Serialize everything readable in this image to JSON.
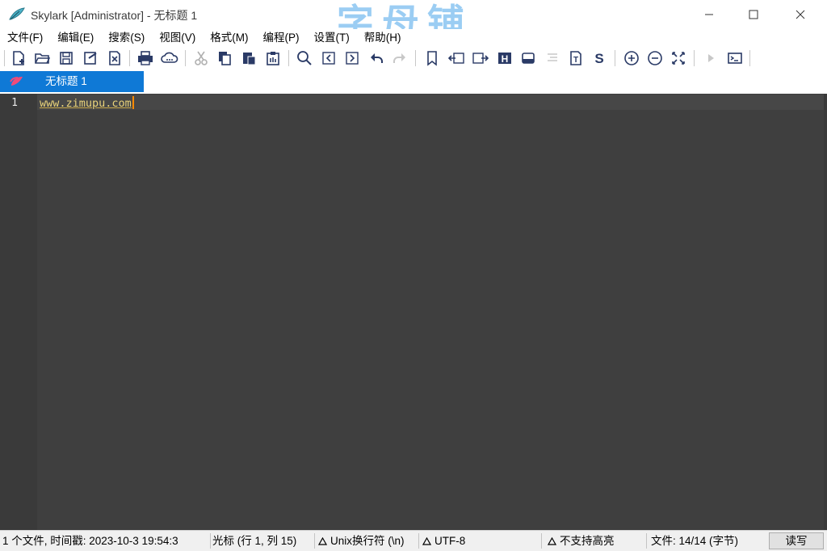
{
  "window": {
    "title": "Skylark [Administrator] - 无标题 1",
    "app_icon": "skylark-feather-icon",
    "controls": [
      "minimize-icon",
      "maximize-icon",
      "close-icon"
    ]
  },
  "watermark": {
    "cn": "字母铺",
    "en": "zimupu.com"
  },
  "menu": [
    {
      "label": "文件(F)"
    },
    {
      "label": "编辑(E)"
    },
    {
      "label": "搜索(S)"
    },
    {
      "label": "视图(V)"
    },
    {
      "label": "格式(M)"
    },
    {
      "label": "编程(P)"
    },
    {
      "label": "设置(T)"
    },
    {
      "label": "帮助(H)"
    }
  ],
  "toolbar": {
    "icons": [
      "new-file-icon",
      "open-folder-icon",
      "save-icon",
      "save-as-icon",
      "close-file-icon",
      "print-icon",
      "cloud-icon",
      "cut-icon",
      "copy-icon",
      "paste-icon",
      "clipboard-icon",
      "search-icon",
      "prev-match-icon",
      "next-match-icon",
      "undo-icon",
      "redo-icon",
      "bookmark-icon",
      "indent-left-icon",
      "indent-right-icon",
      "heading-icon",
      "drive-icon",
      "list-icon",
      "text-icon",
      "s-icon",
      "zoom-in-icon",
      "zoom-out-icon",
      "fullscreen-icon",
      "play-icon",
      "terminal-icon"
    ],
    "h_label": "H",
    "t_label": "T",
    "s_label": "S"
  },
  "tabs": [
    {
      "label": "无标题 1",
      "active": true
    }
  ],
  "editor": {
    "lines": [
      {
        "number": "1",
        "text": "www.zimupu.com"
      }
    ],
    "theme_bg": "#3f3f3f",
    "text_color": "#e8d27a",
    "caret_color": "#ff8a00"
  },
  "status": {
    "file_info": "1 个文件, 时间戳: 2023-10-3 19:54:3",
    "cursor": "光标 (行 1, 列 15)",
    "eol": "Unix换行符 (\\n)",
    "encoding": "UTF-8",
    "highlight": "不支持高亮",
    "file_size": "文件: 14/14 (字节)",
    "mode_button": "读写"
  },
  "colors": {
    "accent": "#0f79d6",
    "toolbar_icon": "#2a3a66",
    "status_bg": "#f0f0f0"
  }
}
